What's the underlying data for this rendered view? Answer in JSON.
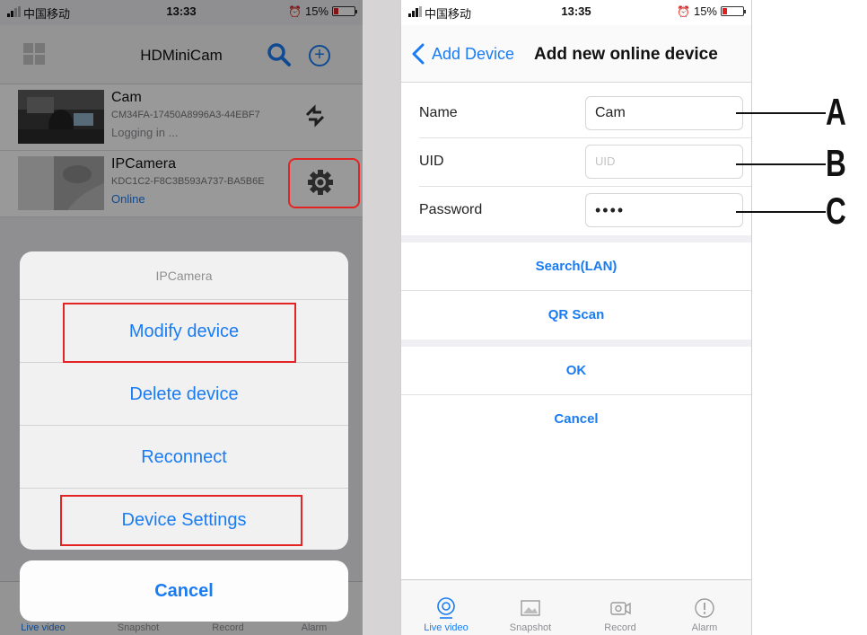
{
  "left": {
    "status": {
      "carrier": "中国移动",
      "time": "13:33",
      "battery": "15%"
    },
    "nav": {
      "title": "HDMiniCam"
    },
    "devices": [
      {
        "name": "Cam",
        "uid": "CM34FA-17450A8996A3-44EBF7",
        "status": "Logging in ...",
        "status_color": "#8e8e93"
      },
      {
        "name": "IPCamera",
        "uid": "KDC1C2-F8C3B593A737-BA5B6E",
        "status": "Online",
        "status_color": "#1a7cf3"
      }
    ],
    "action_sheet": {
      "title": "IPCamera",
      "items": [
        "Modify device",
        "Delete device",
        "Reconnect",
        "Device Settings"
      ],
      "cancel": "Cancel"
    },
    "tabs": [
      "Live video",
      "Snapshot",
      "Record",
      "Alarm"
    ]
  },
  "right": {
    "status": {
      "carrier": "中国移动",
      "time": "13:35",
      "battery": "15%"
    },
    "nav": {
      "back": "Add Device",
      "title": "Add new online device"
    },
    "form": {
      "name_label": "Name",
      "name_value": "Cam",
      "uid_label": "UID",
      "uid_placeholder": "UID",
      "password_label": "Password",
      "password_value": "••••"
    },
    "actions": {
      "search_lan": "Search(LAN)",
      "qr_scan": "QR Scan",
      "ok": "OK",
      "cancel": "Cancel"
    },
    "tabs": [
      "Live video",
      "Snapshot",
      "Record",
      "Alarm"
    ]
  },
  "callouts": [
    "A",
    "B",
    "C"
  ],
  "colors": {
    "accent": "#1a7cf3",
    "highlight": "#e42424",
    "online": "#1a7cf3"
  }
}
